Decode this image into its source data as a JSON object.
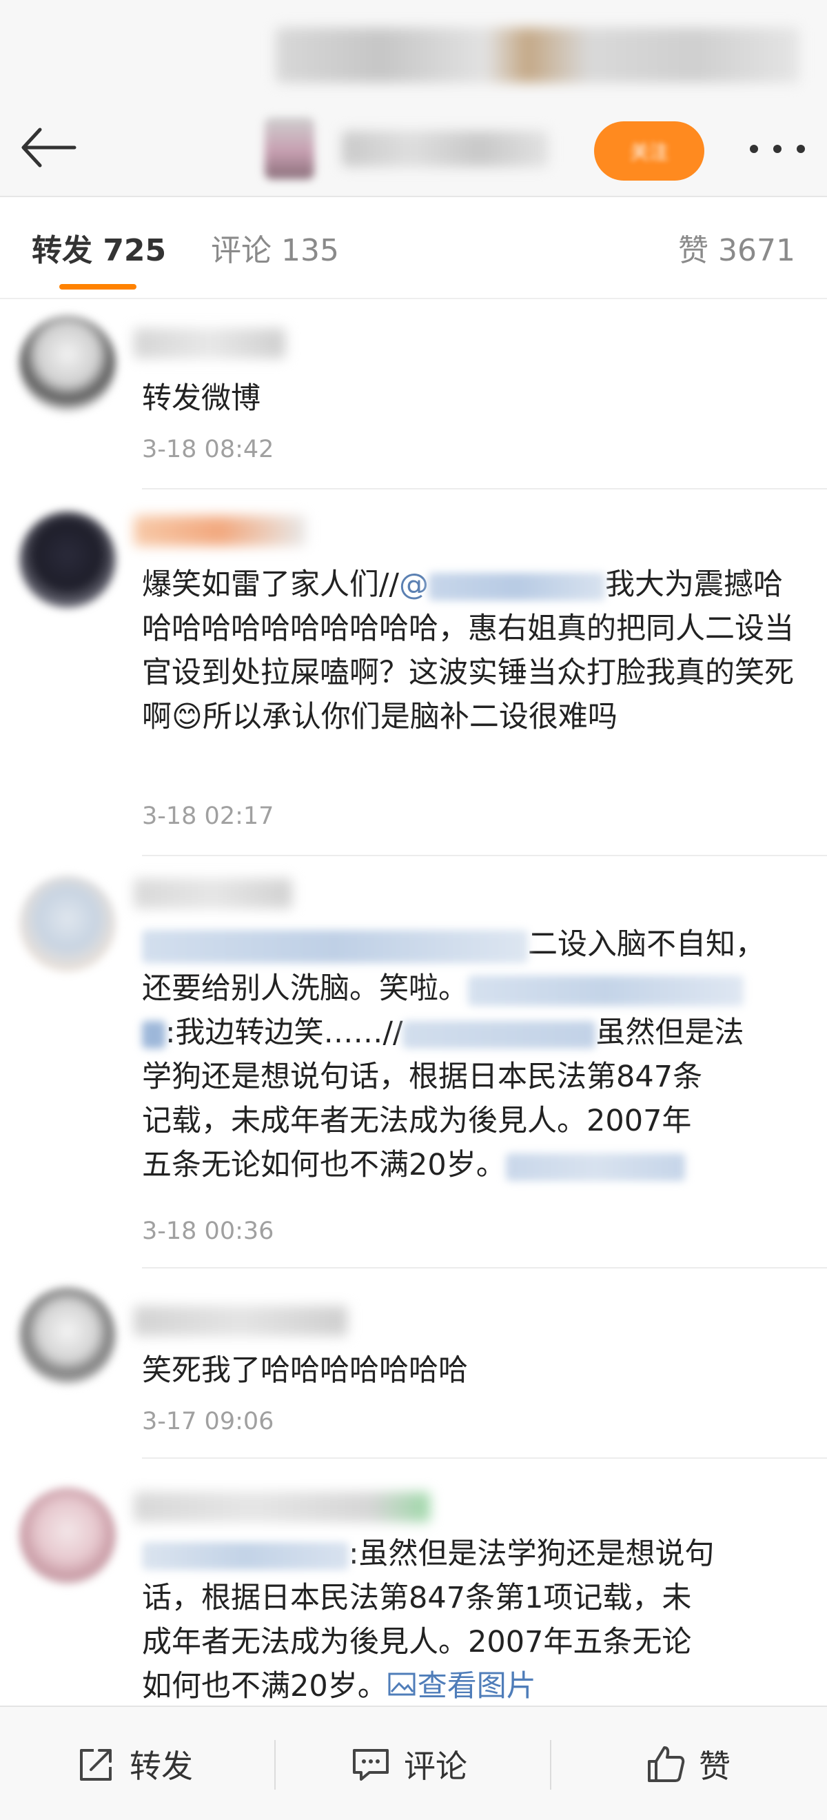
{
  "header": {
    "follow_label": "关注"
  },
  "tabs": {
    "repost": "转发 725",
    "comment": "评论 135",
    "like": "赞 3671"
  },
  "reposts": [
    {
      "text": "转发微博",
      "time": "3-18 08:42"
    },
    {
      "text_a": "爆笑如雷了家人们//",
      "mention_a": "@",
      "text_b": "我大为震撼哈哈哈哈哈哈哈哈哈哈哈，惠右姐真的把同人二设当官设到处拉屎嗑啊？这波实锤当众打脸我真的笑死啊",
      "emoji": "😊",
      "text_c": "所以承认你们是脑补二设很难吗",
      "time": "3-18 02:17"
    },
    {
      "line1": "二设入脑不自知，",
      "line2": "还要给别人洗脑。笑啦。",
      "line3": ":我边转边笑……//",
      "line3_tail": "虽然但是法",
      "line4": "学狗还是想说句话，根据日本民法第847条",
      "line5": "记载，未成年者无法成为後見人。2007年",
      "line6": "五条无论如何也不满20岁。",
      "time": "3-18 00:36"
    },
    {
      "text": "笑死我了哈哈哈哈哈哈哈",
      "time": "3-17 09:06"
    },
    {
      "line1": ":虽然但是法学狗还是想说句",
      "line2": "话，根据日本民法第847条第1项记载，未",
      "line3": "成年者无法成为後見人。2007年五条无论",
      "line4": "如何也不满20岁。",
      "view_image": "查看图片"
    }
  ],
  "bottom": {
    "repost": "转发",
    "comment": "评论",
    "like": "赞"
  },
  "colors": {
    "accent": "#ff8200",
    "follow_bg": "#ff8a1f",
    "link": "#4f7db9",
    "time": "#a0a0a0"
  }
}
